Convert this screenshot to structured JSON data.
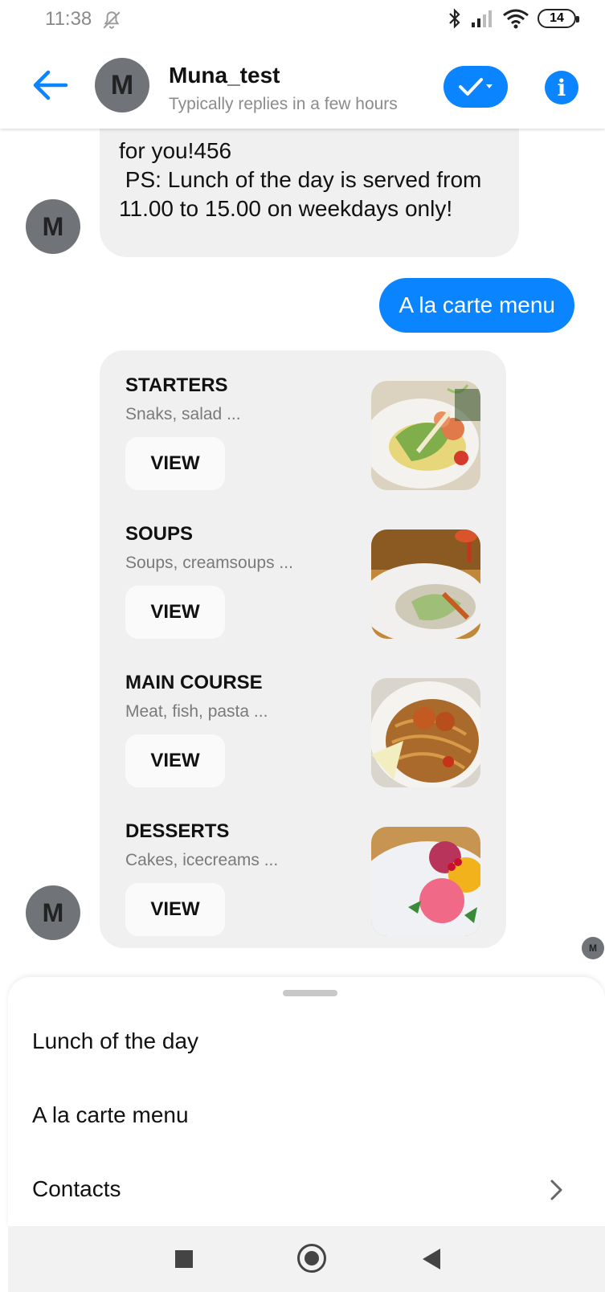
{
  "status": {
    "time": "11:38",
    "battery": "14",
    "icons": [
      "mute-icon",
      "bluetooth-icon",
      "signal-icon",
      "wifi-icon",
      "battery-icon"
    ]
  },
  "header": {
    "avatar_letter": "M",
    "title": "Muna_test",
    "subtitle": "Typically replies in a few hours",
    "icons": [
      "back-arrow-icon",
      "check-dropdown-icon",
      "info-icon"
    ],
    "accent": "#0a84ff"
  },
  "chat": {
    "incoming_text": "for you!456\n PS: Lunch of the day is served from 11.00 to 15.00 on weekdays only!",
    "avatar_letter": "M",
    "outgoing_text": "A la carte menu",
    "read_avatar_letter": "M",
    "menu": [
      {
        "title": "STARTERS",
        "subtitle": "Snaks, salad ...",
        "button": "VIEW"
      },
      {
        "title": "SOUPS",
        "subtitle": "Soups, creamsoups ...",
        "button": "VIEW"
      },
      {
        "title": "MAIN COURSE",
        "subtitle": "Meat, fish, pasta ...",
        "button": "VIEW"
      },
      {
        "title": "DESSERTS",
        "subtitle": "Cakes, icecreams ...",
        "button": "VIEW"
      }
    ]
  },
  "quick_replies": {
    "items": [
      "Lunch of the day",
      "A la carte menu",
      "Contacts"
    ]
  },
  "navigation": {
    "icons": [
      "recent-apps-icon",
      "home-icon",
      "back-icon"
    ]
  }
}
